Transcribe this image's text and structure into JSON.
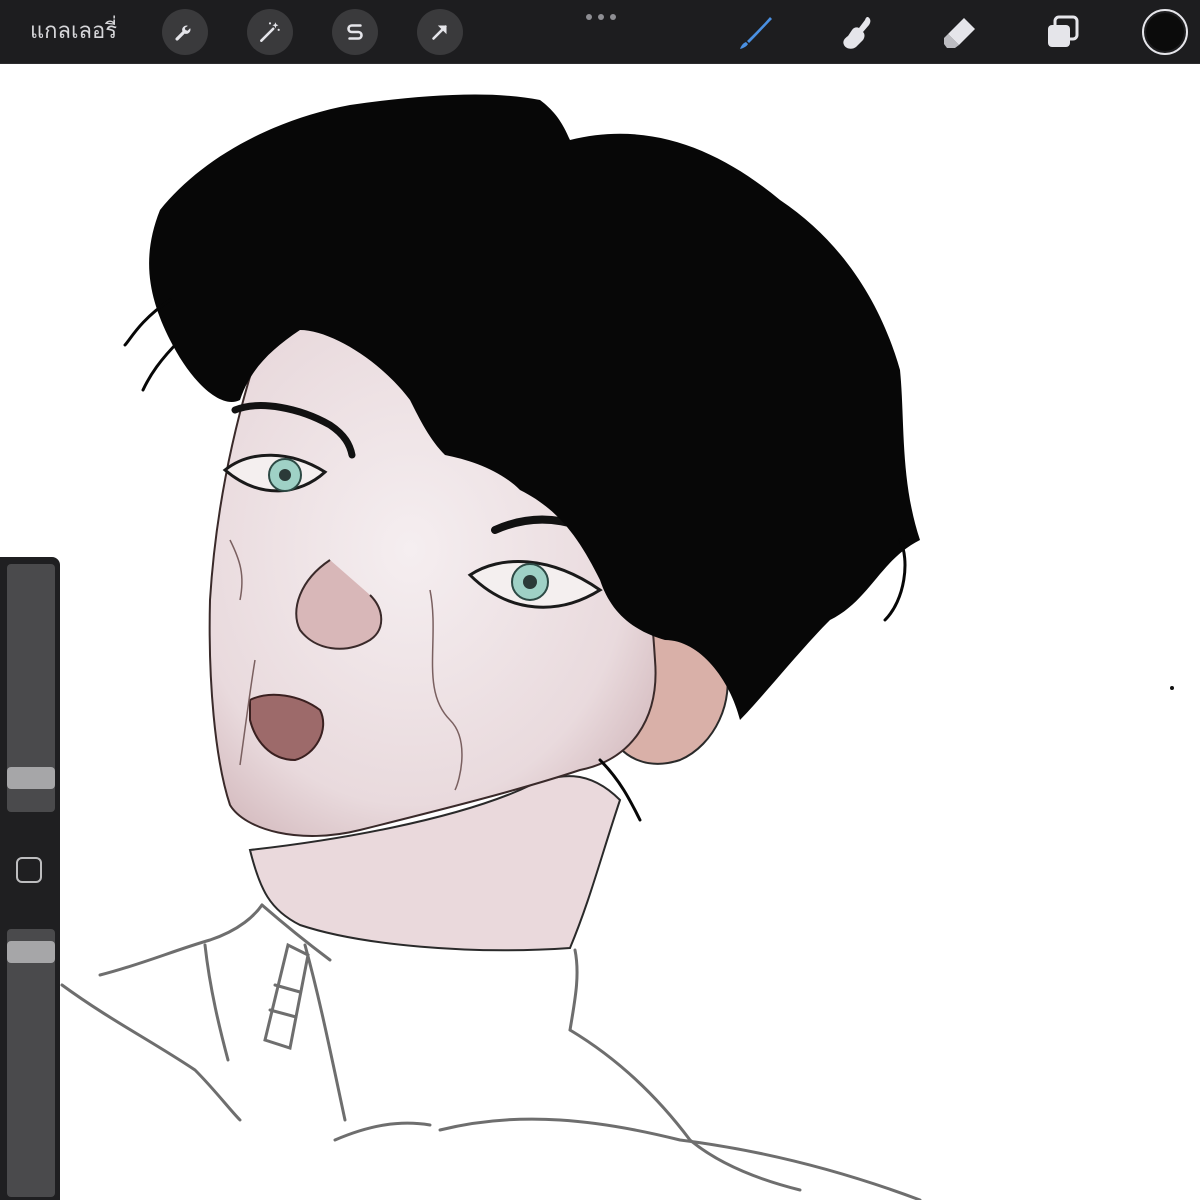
{
  "toolbar": {
    "gallery_label": "แกลเลอรี่",
    "left_tools": [
      {
        "name": "actions",
        "icon": "wrench-icon"
      },
      {
        "name": "adjustments",
        "icon": "magic-wand-icon"
      },
      {
        "name": "selection",
        "icon": "selection-s-icon"
      },
      {
        "name": "transform",
        "icon": "arrow-cursor-icon"
      }
    ],
    "more_icon": "ellipsis-icon",
    "right_tools": [
      {
        "name": "paint",
        "icon": "brush-icon",
        "active": true
      },
      {
        "name": "smudge",
        "icon": "smudge-finger-icon",
        "active": false
      },
      {
        "name": "erase",
        "icon": "eraser-icon",
        "active": false
      },
      {
        "name": "layers",
        "icon": "layers-icon",
        "active": false
      }
    ],
    "current_color": "#0b0b0b"
  },
  "sidebar": {
    "brush_size_level": 0.1,
    "modify_icon": "square-icon",
    "opacity_level": 0.95
  },
  "colors": {
    "toolbar_bg": "#1d1d1f",
    "accent": "#4a90e2",
    "canvas_bg": "#ffffff"
  }
}
